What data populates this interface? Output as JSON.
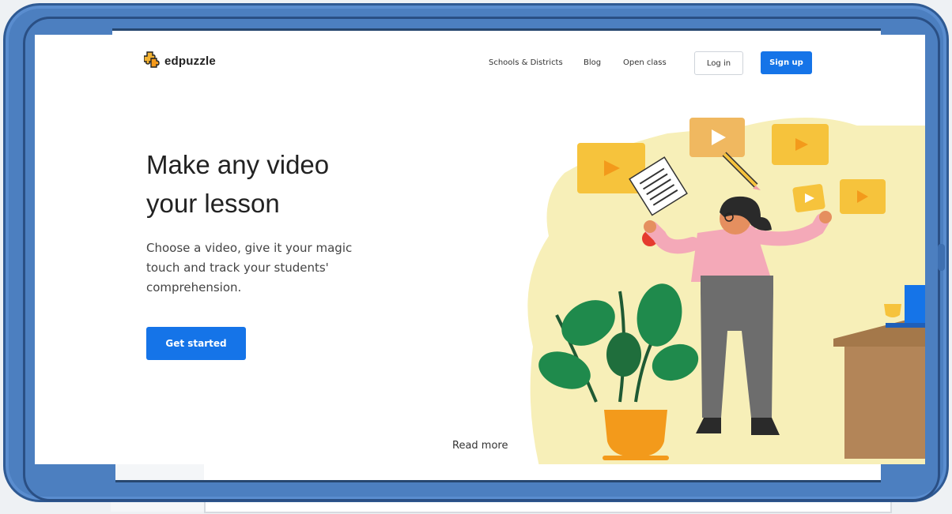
{
  "brand": {
    "name": "edpuzzle"
  },
  "nav": {
    "links": [
      "Schools & Districts",
      "Blog",
      "Open class"
    ],
    "login_label": "Log in",
    "signup_label": "Sign up"
  },
  "hero": {
    "headline_line1": "Make any video",
    "headline_line2": "your lesson",
    "subtext_line1": "Choose a video, give it your magic",
    "subtext_line2": "touch and track your students'",
    "subtext_line3": "comprehension.",
    "cta_label": "Get started"
  },
  "footer": {
    "read_more": "Read more"
  },
  "colors": {
    "primary_blue": "#1574e8",
    "frame_blue": "#4c7fc0",
    "illustration_yellow": "#f7efb8",
    "video_card_yellow": "#f6c33c",
    "person_shirt": "#f4a9b8",
    "plant_green": "#1f8a4c",
    "pot_orange": "#f39a1b",
    "desk_brown": "#a4784a"
  },
  "icons": {
    "logo": "puzzle-piece-icon",
    "illustration": "teacher-with-videos-illustration"
  }
}
